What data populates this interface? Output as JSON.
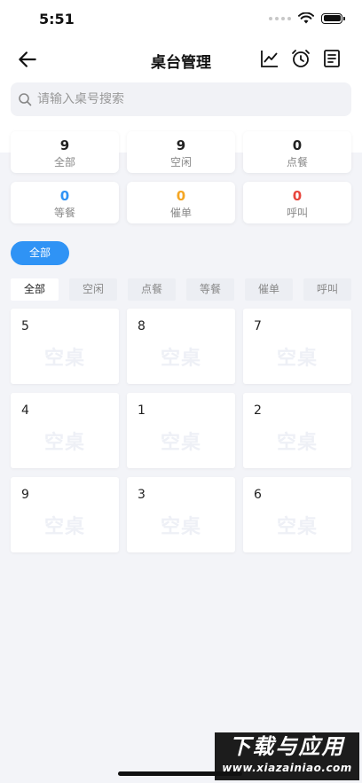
{
  "status_bar": {
    "time": "5:51"
  },
  "nav": {
    "title": "桌台管理",
    "icons": [
      "back-arrow-icon",
      "chart-icon",
      "alarm-clock-icon",
      "document-icon"
    ]
  },
  "search": {
    "placeholder": "请输入桌号搜索",
    "value": ""
  },
  "stats": [
    {
      "num": "9",
      "label": "全部",
      "color": "#222222"
    },
    {
      "num": "9",
      "label": "空闲",
      "color": "#222222"
    },
    {
      "num": "0",
      "label": "点餐",
      "color": "#222222"
    },
    {
      "num": "0",
      "label": "等餐",
      "color": "#2f93f5"
    },
    {
      "num": "0",
      "label": "催单",
      "color": "#f5a623"
    },
    {
      "num": "0",
      "label": "呼叫",
      "color": "#e8453c"
    }
  ],
  "filter_chip": {
    "label": "全部"
  },
  "tabs": [
    "全部",
    "空闲",
    "点餐",
    "等餐",
    "催单",
    "呼叫"
  ],
  "active_tab": "全部",
  "tables": [
    {
      "no": "5",
      "status": "空桌"
    },
    {
      "no": "8",
      "status": "空桌"
    },
    {
      "no": "7",
      "status": "空桌"
    },
    {
      "no": "4",
      "status": "空桌"
    },
    {
      "no": "1",
      "status": "空桌"
    },
    {
      "no": "2",
      "status": "空桌"
    },
    {
      "no": "9",
      "status": "空桌"
    },
    {
      "no": "3",
      "status": "空桌"
    },
    {
      "no": "6",
      "status": "空桌"
    }
  ],
  "watermark": {
    "title": "下载与应用",
    "url": "www.xiazainiao.com"
  },
  "colors": {
    "accent": "#2f93f5",
    "background": "#f3f4f8"
  }
}
